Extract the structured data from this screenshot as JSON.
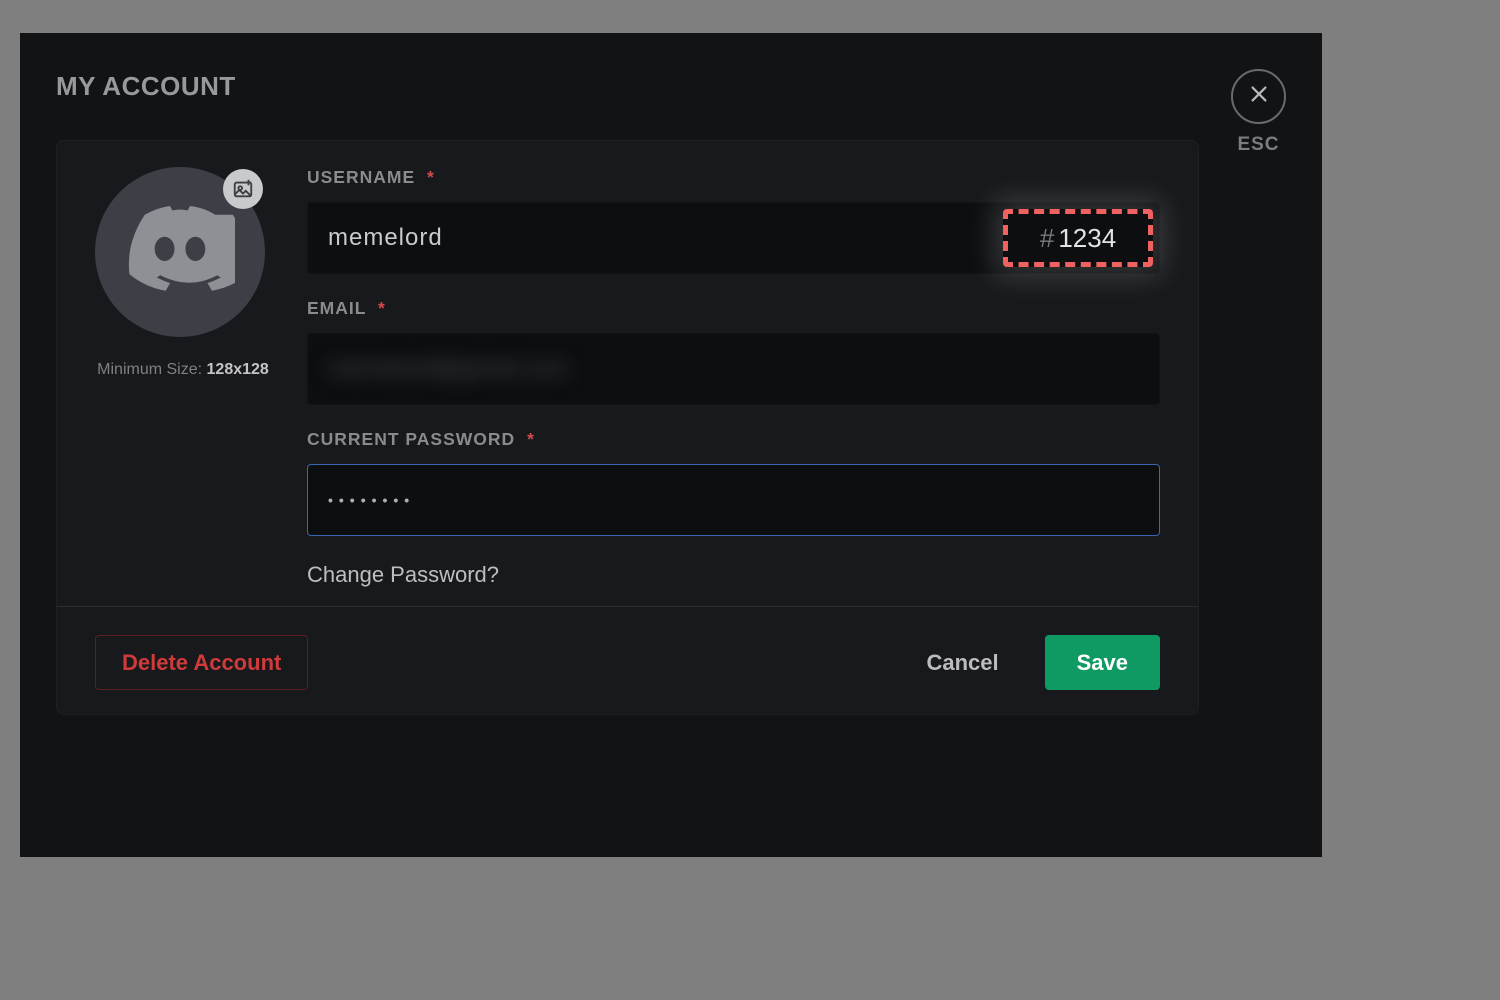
{
  "title": "MY ACCOUNT",
  "close": {
    "esc": "ESC"
  },
  "avatar": {
    "min_size_prefix": "Minimum Size: ",
    "min_size_value": "128x128"
  },
  "fields": {
    "username": {
      "label": "USERNAME",
      "value": "memelord",
      "discriminator_hash": "#",
      "discriminator": "1234"
    },
    "email": {
      "label": "EMAIL",
      "value_masked": "memelord@gmail.com"
    },
    "password": {
      "label": "CURRENT PASSWORD",
      "dots": "••••••••"
    },
    "required_mark": "*"
  },
  "change_password": "Change Password?",
  "buttons": {
    "delete": "Delete Account",
    "cancel": "Cancel",
    "save": "Save"
  }
}
